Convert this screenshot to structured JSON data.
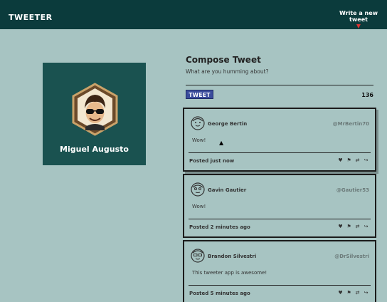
{
  "nav": {
    "logo": "TWEETER",
    "write_new": "Write a new tweet",
    "write_new_arrow": "▼"
  },
  "profile": {
    "name": "Miguel Augusto"
  },
  "compose": {
    "title": "Compose Tweet",
    "subtitle": "What are you humming about?",
    "button_label": "TWEET",
    "counter": "136"
  },
  "tweets": [
    {
      "name": "George Bertin",
      "handle": "@MrBertin70",
      "text": "Wow!",
      "posted": "Posted just now"
    },
    {
      "name": "Gavin Gautier",
      "handle": "@Gautier53",
      "text": "Wow!",
      "posted": "Posted 2 minutes ago"
    },
    {
      "name": "Brandon Silvestri",
      "handle": "@DrSilvestri",
      "text": "This tweeter app is awesome!",
      "posted": "Posted 5 minutes ago"
    }
  ],
  "icons": [
    "heart-icon",
    "flag-icon",
    "retweet-icon",
    "share-icon"
  ]
}
